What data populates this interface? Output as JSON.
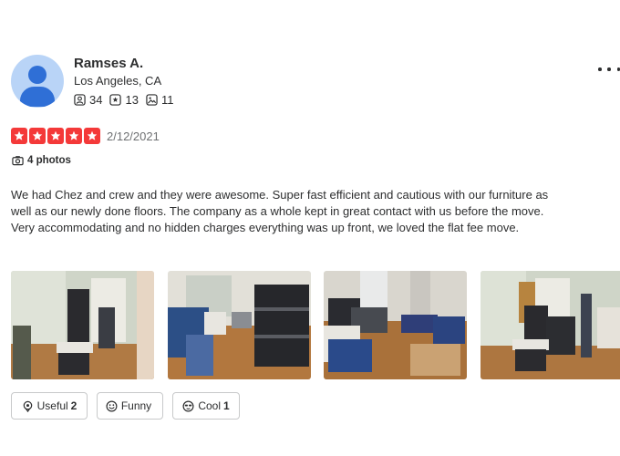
{
  "reviewer": {
    "name": "Ramses A.",
    "location": "Los Angeles, CA",
    "stats": {
      "friends": "34",
      "reviews": "13",
      "photos": "11"
    }
  },
  "review": {
    "rating": 5,
    "date": "2/12/2021",
    "photos_label": "4 photos",
    "text": "We had Chez and crew and they were awesome.  Super fast efficient and cautious with our furniture as well as our newly done floors.  The company as a whole kept in great contact with us before the move.  Very accommodating and no hidden charges everything was up front, we loved the flat fee move."
  },
  "reactions": {
    "useful": {
      "label": "Useful",
      "count": "2"
    },
    "funny": {
      "label": "Funny",
      "count": ""
    },
    "cool": {
      "label": "Cool",
      "count": "1"
    }
  },
  "colors": {
    "star": "#f43939",
    "avatar_bg": "#b9d4f7",
    "avatar_fg": "#2f6fd6"
  }
}
